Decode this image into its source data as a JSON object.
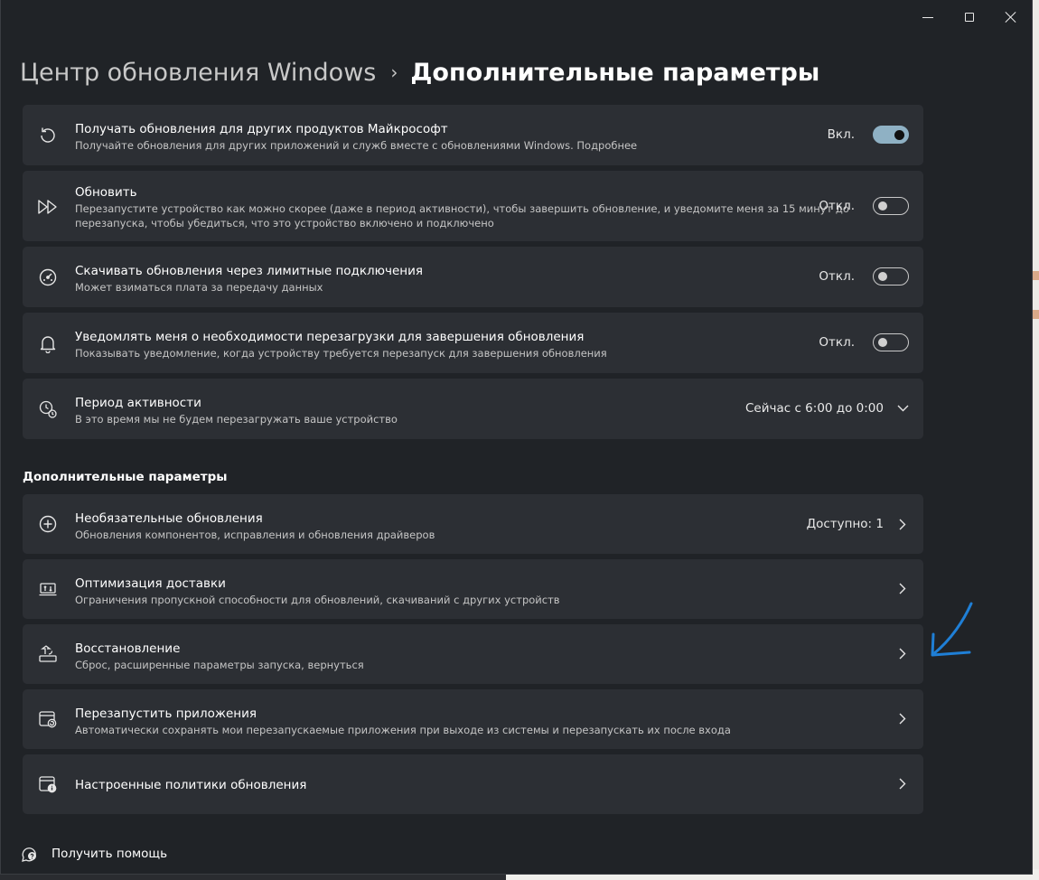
{
  "window": {
    "controls": [
      "minimize-icon",
      "maximize-icon",
      "close-icon"
    ]
  },
  "breadcrumb": {
    "parent": "Центр обновления Windows",
    "separator": "›",
    "current": "Дополнительные параметры"
  },
  "settings": [
    {
      "icon": "refresh-icon",
      "title": "Получать обновления для других продуктов Майкрософт",
      "desc": "Получайте обновления для других приложений и служб вместе с обновлениями Windows. Подробнее",
      "state": "Вкл.",
      "toggle_on": true
    },
    {
      "icon": "fast-forward-icon",
      "title": "Обновить",
      "desc": "Перезапустите устройство как можно скорее (даже в период активности), чтобы завершить обновление, и уведомите меня за 15 минут до",
      "desc2": "перезапуска, чтобы убедиться, что это устройство включено и подключено",
      "state": "Откл.",
      "toggle_on": false
    },
    {
      "icon": "gauge-icon",
      "title": "Скачивать обновления через лимитные подключения",
      "desc": "Может взиматься плата за передачу данных",
      "state": "Откл.",
      "toggle_on": false
    },
    {
      "icon": "bell-icon",
      "title": "Уведомлять меня о необходимости перезагрузки для завершения обновления",
      "desc": "Показывать уведомление, когда устройству требуется перезапуск для завершения обновления",
      "state": "Откл.",
      "toggle_on": false
    },
    {
      "icon": "active-hours-icon",
      "title": "Период активности",
      "desc": "В это время мы не будем перезагружать ваше устройство",
      "value": "Сейчас с 6:00 до 0:00"
    }
  ],
  "additional_section": {
    "title": "Дополнительные параметры",
    "items": [
      {
        "icon": "plus-circle-icon",
        "title": "Необязательные обновления",
        "desc": "Обновления компонентов, исправления и обновления драйверов",
        "value": "Доступно: 1"
      },
      {
        "icon": "delivery-optimization-icon",
        "title": "Оптимизация доставки",
        "desc": "Ограничения пропускной способности для обновлений, скачиваний с других устройств",
        "value": ""
      },
      {
        "icon": "recovery-icon",
        "title": "Восстановление",
        "desc": "Сброс, расширенные параметры запуска, вернуться",
        "value": ""
      },
      {
        "icon": "restart-apps-icon",
        "title": "Перезапустить приложения",
        "desc": "Автоматически сохранять мои перезапускаемые приложения при выходе из системы и перезапускать их после входа",
        "value": ""
      },
      {
        "icon": "policy-icon",
        "title": "Настроенные политики обновления",
        "desc": "",
        "value": ""
      }
    ]
  },
  "help": {
    "label": "Получить помощь",
    "icon": "help-icon"
  },
  "colors": {
    "window_bg": "#202327",
    "card_bg": "#2c2f34",
    "toggle_on": "#8fb1c4",
    "annotation_arrow": "#1f7fd6"
  }
}
